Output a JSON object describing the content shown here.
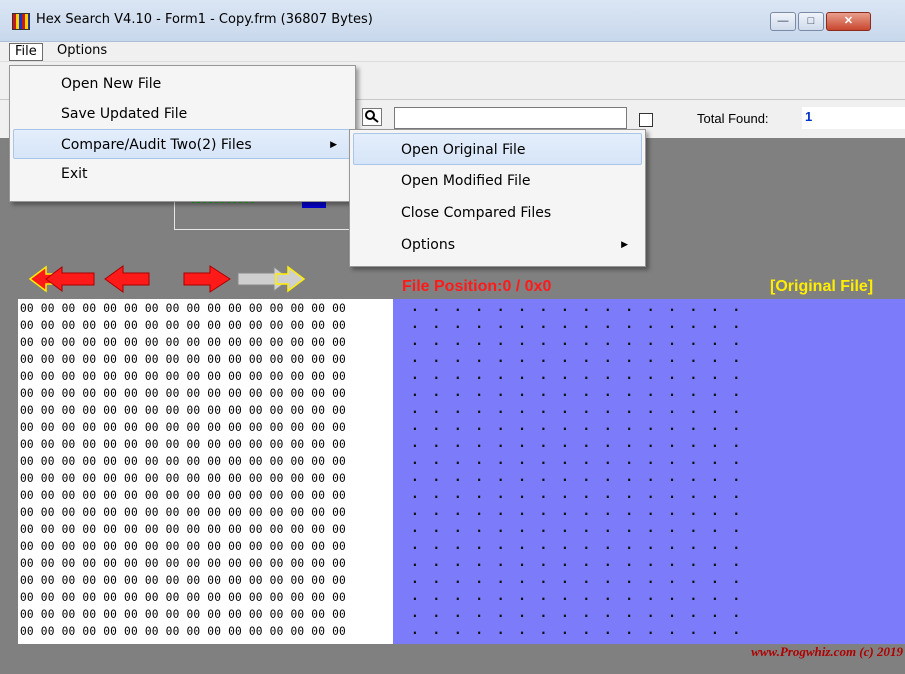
{
  "window": {
    "title": "Hex Search V4.10 - Form1 - Copy.frm (36807 Bytes)",
    "min_symbol": "—",
    "max_symbol": "□",
    "close_symbol": "✕"
  },
  "menubar": {
    "file": "File",
    "options": "Options"
  },
  "file_menu": {
    "items": [
      "Open New File",
      "Save Updated File",
      "Compare/Audit Two(2) Files",
      "Exit"
    ]
  },
  "compare_submenu": {
    "items": [
      "Open Original File",
      "Open Modified File",
      "Close Compared Files",
      "Options"
    ]
  },
  "search": {
    "value": "",
    "total_found_label": "Total Found:",
    "total_found_value": "1"
  },
  "status": {
    "file_position": "File Position:0 / 0x0",
    "file_kind": "[Original File]"
  },
  "hex_rows": [
    "00 00 00 00 00 00 00 00 00 00 00 00 00 00 00 00",
    "00 00 00 00 00 00 00 00 00 00 00 00 00 00 00 00",
    "00 00 00 00 00 00 00 00 00 00 00 00 00 00 00 00",
    "00 00 00 00 00 00 00 00 00 00 00 00 00 00 00 00",
    "00 00 00 00 00 00 00 00 00 00 00 00 00 00 00 00",
    "00 00 00 00 00 00 00 00 00 00 00 00 00 00 00 00",
    "00 00 00 00 00 00 00 00 00 00 00 00 00 00 00 00",
    "00 00 00 00 00 00 00 00 00 00 00 00 00 00 00 00",
    "00 00 00 00 00 00 00 00 00 00 00 00 00 00 00 00",
    "00 00 00 00 00 00 00 00 00 00 00 00 00 00 00 00",
    "00 00 00 00 00 00 00 00 00 00 00 00 00 00 00 00",
    "00 00 00 00 00 00 00 00 00 00 00 00 00 00 00 00",
    "00 00 00 00 00 00 00 00 00 00 00 00 00 00 00 00",
    "00 00 00 00 00 00 00 00 00 00 00 00 00 00 00 00",
    "00 00 00 00 00 00 00 00 00 00 00 00 00 00 00 00",
    "00 00 00 00 00 00 00 00 00 00 00 00 00 00 00 00",
    "00 00 00 00 00 00 00 00 00 00 00 00 00 00 00 00",
    "00 00 00 00 00 00 00 00 00 00 00 00 00 00 00 00",
    "00 00 00 00 00 00 00 00 00 00 00 00 00 00 00 00",
    "00 00 00 00 00 00 00 00 00 00 00 00 00 00 00 00"
  ],
  "ascii_rows": [
    "................",
    "................",
    "................",
    "................",
    "................",
    "................",
    "................",
    "................",
    "................",
    "................",
    "................",
    "................",
    "................",
    "................",
    "................",
    "................",
    "................",
    "................",
    "................",
    "................"
  ],
  "footer": {
    "credit": "www.Progwhiz.com (c) 2019"
  },
  "colors": {
    "ascii_bg": "#7c7cfa",
    "main_bg": "#808080",
    "file_position": "#ff1a1a",
    "file_kind": "#ffee00",
    "credit": "#b00000",
    "arrow_red": "#ff1a1a",
    "arrow_grey": "#cfcfcf"
  },
  "icons": {
    "nav": [
      "first-page-icon",
      "prev-page-icon",
      "next-page-icon",
      "last-page-icon"
    ],
    "search": "search-icon"
  }
}
